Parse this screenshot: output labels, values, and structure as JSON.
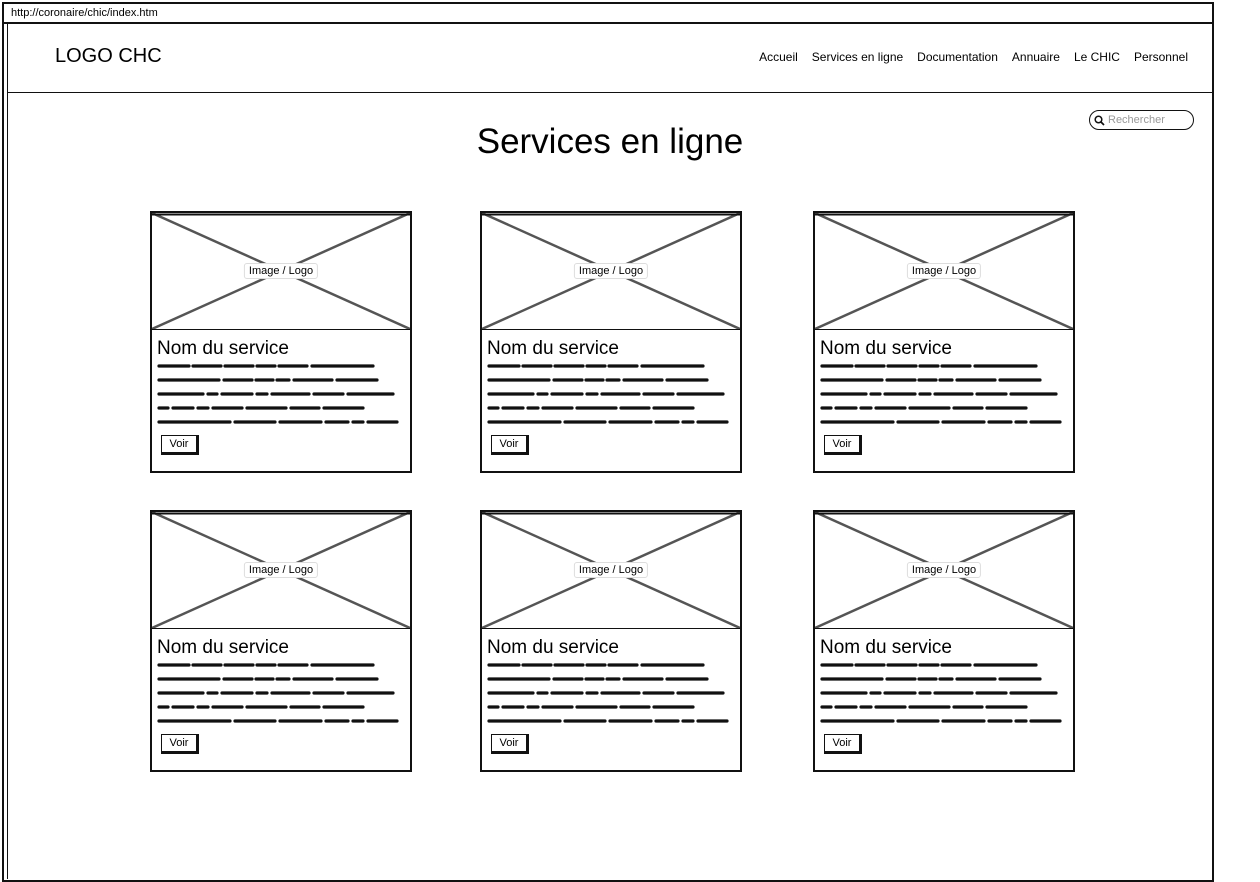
{
  "browser": {
    "url": "http://coronaire/chic/index.htm"
  },
  "header": {
    "logo": "LOGO CHC",
    "nav": [
      "Accueil",
      "Services en ligne",
      "Documentation",
      "Annuaire",
      "Le CHIC",
      "Personnel"
    ]
  },
  "search": {
    "placeholder": "Rechercher",
    "icon": "search-icon"
  },
  "page": {
    "title": "Services en ligne"
  },
  "cards": [
    {
      "image_label": "Image / Logo",
      "name": "Nom du service",
      "button": "Voir"
    },
    {
      "image_label": "Image / Logo",
      "name": "Nom du service",
      "button": "Voir"
    },
    {
      "image_label": "Image / Logo",
      "name": "Nom du service",
      "button": "Voir"
    },
    {
      "image_label": "Image / Logo",
      "name": "Nom du service",
      "button": "Voir"
    },
    {
      "image_label": "Image / Logo",
      "name": "Nom du service",
      "button": "Voir"
    },
    {
      "image_label": "Image / Logo",
      "name": "Nom du service",
      "button": "Voir"
    }
  ]
}
